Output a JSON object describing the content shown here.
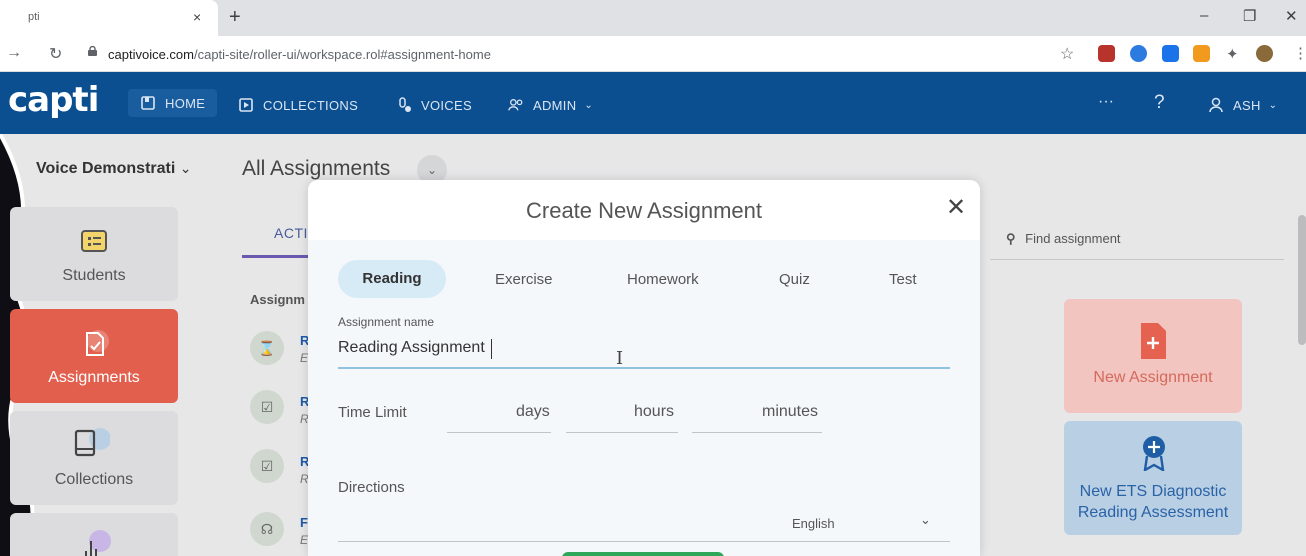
{
  "browser": {
    "tab_title": "pti",
    "tab_close": "×",
    "new_tab": "+",
    "url_host": "captivoice.com",
    "url_path": "/capti-site/roller-ui/workspace.rol#assignment-home",
    "window_min": "–",
    "window_max": "❐",
    "window_close": "✕"
  },
  "app": {
    "logo": "capti",
    "nav": {
      "home": "HOME",
      "collections": "COLLECTIONS",
      "voices": "VOICES",
      "admin": "ADMIN"
    },
    "more": "···",
    "help": "?",
    "user": "ASH"
  },
  "page": {
    "org": "Voice Demonstrati",
    "title": "All Assignments",
    "tab_active": "ACTI",
    "col_header": "Assignm",
    "rows": [
      {
        "t": "R",
        "s": "E",
        "icon": "⌛"
      },
      {
        "t": "R",
        "s": "R",
        "icon": "☑"
      },
      {
        "t": "R",
        "s": "R",
        "icon": "☑"
      },
      {
        "t": "F",
        "s": "E",
        "icon": "☊"
      }
    ],
    "search_placeholder": "Find assignment",
    "card_new": "New Assignment",
    "card_ets": "New ETS Diagnostic Reading Assessment"
  },
  "sidebar": {
    "students": "Students",
    "assignments": "Assignments",
    "collections": "Collections"
  },
  "modal": {
    "title": "Create New Assignment",
    "close": "✕",
    "types": [
      "Reading",
      "Exercise",
      "Homework",
      "Quiz",
      "Test"
    ],
    "name_label": "Assignment name",
    "name_value": "Reading Assignment",
    "time_limit_label": "Time Limit",
    "days": "days",
    "hours": "hours",
    "minutes": "minutes",
    "directions_label": "Directions",
    "language": "English"
  },
  "colors": {
    "header": "#0b4f91",
    "active_side": "#e25f4d",
    "accent_blue": "#8fc3e0",
    "green": "#2fa75a"
  }
}
